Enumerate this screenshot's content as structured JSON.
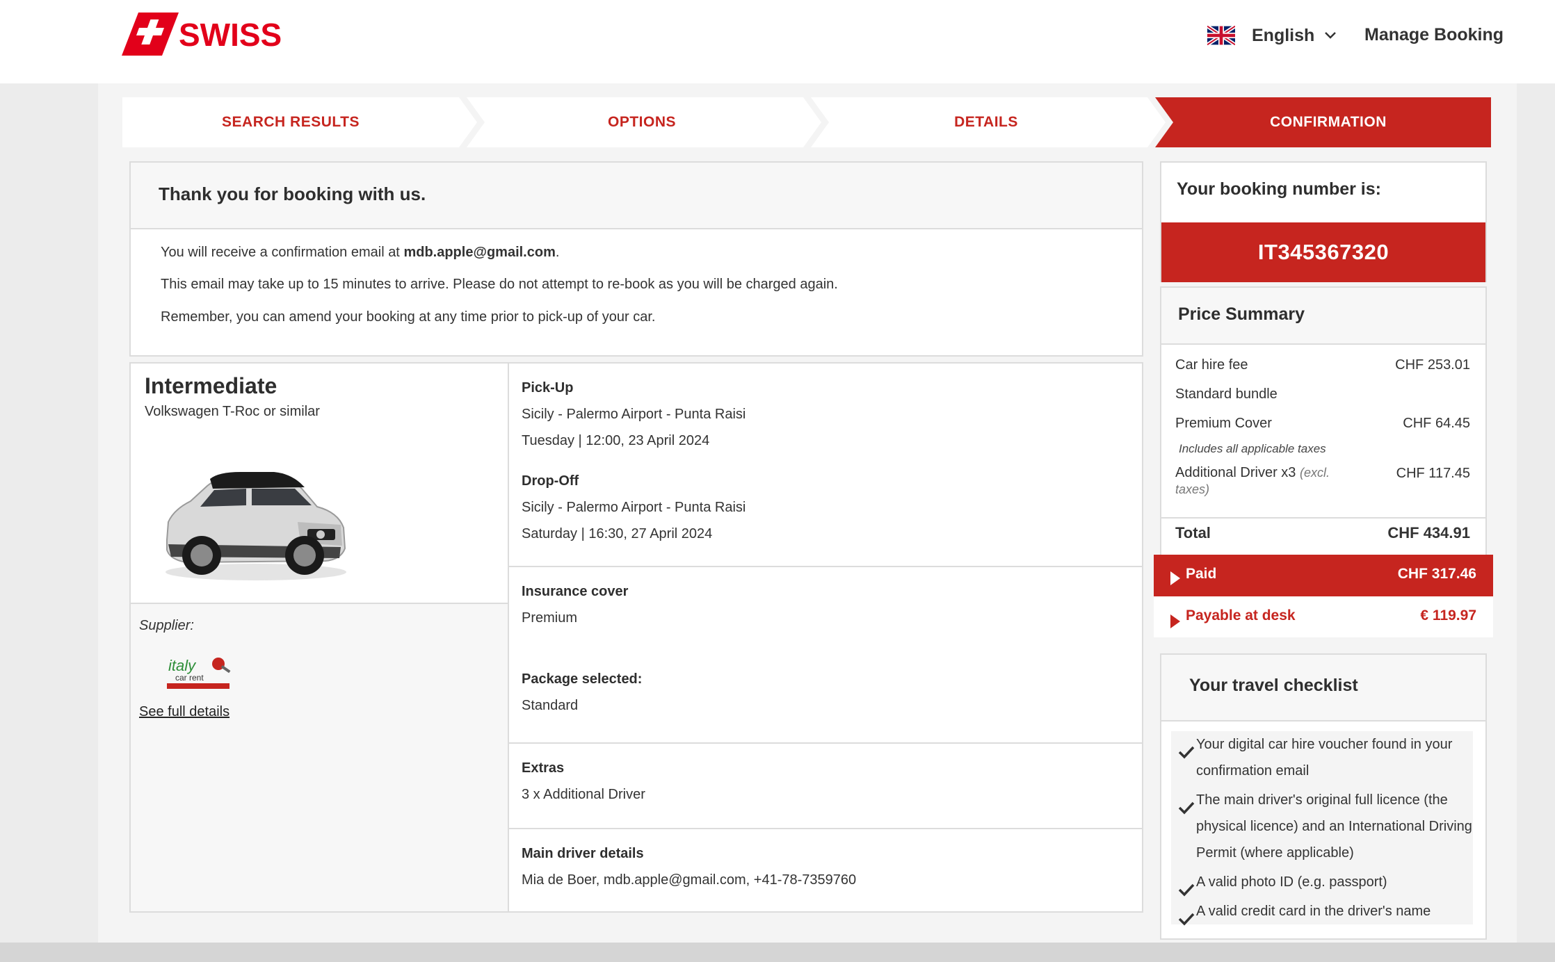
{
  "header": {
    "brand": "SWISS",
    "language": "English",
    "manage_booking": "Manage Booking"
  },
  "steps": [
    {
      "label": "SEARCH RESULTS",
      "active": false
    },
    {
      "label": "OPTIONS",
      "active": false
    },
    {
      "label": "DETAILS",
      "active": false
    },
    {
      "label": "CONFIRMATION",
      "active": true
    }
  ],
  "thank_you": {
    "title": "Thank you for booking with us.",
    "email_prefix": "You will receive a confirmation email at ",
    "email": "mdb.apple@gmail.com",
    "email_suffix": ".",
    "line2": "This email may take up to 15 minutes to arrive. Please do not attempt to re-book as you will be charged again.",
    "line3": "Remember, you can amend your booking at any time prior to pick-up of your car."
  },
  "car": {
    "category": "Intermediate",
    "model": "Volkswagen T-Roc or similar",
    "supplier_label": "Supplier:",
    "supplier_logo_text": "italy car rent",
    "see_full_details": "See full details"
  },
  "trip": {
    "pickup_heading": "Pick-Up",
    "pickup_location": "Sicily - Palermo Airport - Punta Raisi",
    "pickup_datetime": "Tuesday | 12:00, 23 April 2024",
    "dropoff_heading": "Drop-Off",
    "dropoff_location": "Sicily - Palermo Airport - Punta Raisi",
    "dropoff_datetime": "Saturday | 16:30, 27 April 2024",
    "insurance_heading": "Insurance cover",
    "insurance_value": "Premium",
    "package_heading": "Package selected:",
    "package_value": "Standard",
    "extras_heading": "Extras",
    "extras_value": "3 x Additional Driver",
    "driver_heading": "Main driver details",
    "driver_value": "Mia de Boer, mdb.apple@gmail.com, +41-78-7359760"
  },
  "booking": {
    "title": "Your booking number is:",
    "number": "IT345367320"
  },
  "price_summary": {
    "title": "Price Summary",
    "car_hire_label": "Car hire fee",
    "car_hire_value": "CHF 253.01",
    "bundle_label": "Standard bundle",
    "premium_label": "Premium Cover",
    "premium_value": "CHF 64.45",
    "taxes_note": "Includes all applicable taxes",
    "additional_label": "Additional Driver x3",
    "additional_excl": "(excl. taxes)",
    "additional_value": "CHF 117.45",
    "total_label": "Total",
    "total_value": "CHF 434.91",
    "paid_label": "Paid",
    "paid_value": "CHF 317.46",
    "desk_label": "Payable at desk",
    "desk_value": "€ 119.97"
  },
  "checklist": {
    "title": "Your travel checklist",
    "items": [
      "Your digital car hire voucher found in your confirmation email",
      "The main driver's original full licence (the physical licence) and an International Driving Permit (where applicable)",
      "A valid photo ID (e.g. passport)",
      "A valid credit card in the driver's name"
    ]
  },
  "colors": {
    "brand_red": "#c6251f",
    "text": "#333333",
    "panel_bg": "#f7f7f7"
  }
}
